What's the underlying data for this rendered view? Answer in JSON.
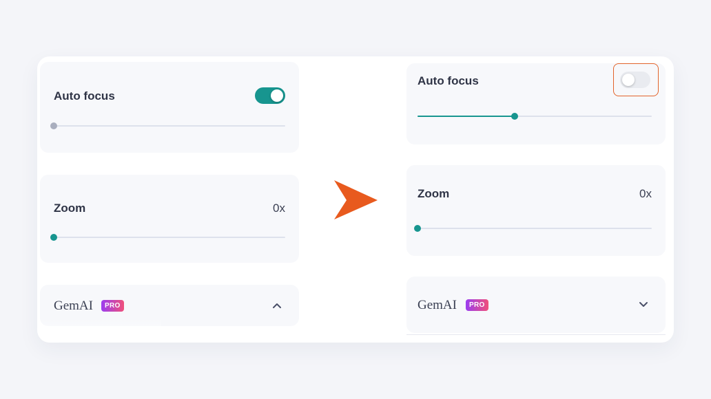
{
  "before": {
    "autofocus": {
      "label": "Auto focus",
      "toggle_on": true,
      "slider_value_fraction": 0.0
    },
    "zoom": {
      "label": "Zoom",
      "value": "0x",
      "slider_value_fraction": 0.0
    },
    "gemai": {
      "brand": "GemAI",
      "badge": "PRO",
      "expanded": true
    }
  },
  "after": {
    "autofocus": {
      "label": "Auto focus",
      "toggle_on": false,
      "slider_value_fraction": 0.4
    },
    "zoom": {
      "label": "Zoom",
      "value": "0x",
      "slider_value_fraction": 0.0
    },
    "gemai": {
      "brand": "GemAI",
      "badge": "PRO",
      "expanded": false
    }
  },
  "colors": {
    "accent": "#17958f",
    "highlight": "#e2632a",
    "arrow": "#e85a1e",
    "track": "#dde1ec",
    "thumb_inactive": "#a9aebe"
  },
  "icons": {
    "transition": "arrow-right-icon",
    "collapse": "chevron-up-icon",
    "expand": "chevron-down-icon"
  }
}
